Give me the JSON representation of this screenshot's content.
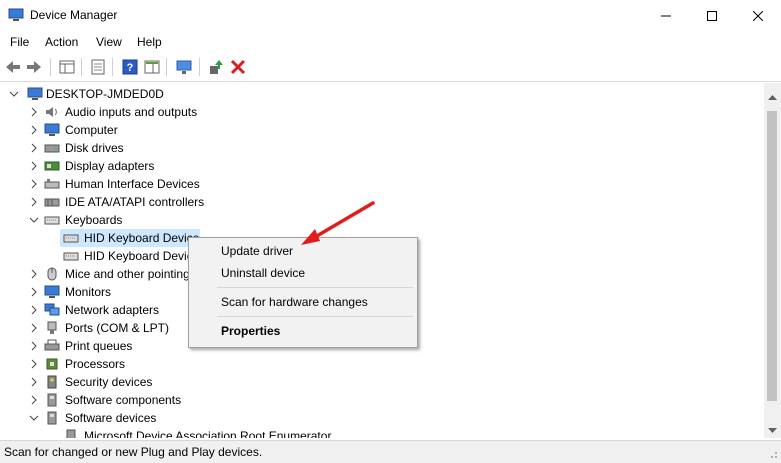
{
  "window": {
    "title": "Device Manager"
  },
  "menu": [
    "File",
    "Action",
    "View",
    "Help"
  ],
  "tree": {
    "root": "DESKTOP-JMDED0D",
    "categories": [
      "Audio inputs and outputs",
      "Computer",
      "Disk drives",
      "Display adapters",
      "Human Interface Devices",
      "IDE ATA/ATAPI controllers",
      "Keyboards",
      "Mice and other pointing devices",
      "Monitors",
      "Network adapters",
      "Ports (COM & LPT)",
      "Print queues",
      "Processors",
      "Security devices",
      "Software components",
      "Software devices"
    ],
    "keyboard_devices": [
      "HID Keyboard Device",
      "HID Keyboard Device"
    ],
    "software_devices": [
      "Microsoft Device Association Root Enumerator"
    ]
  },
  "context_menu": {
    "update": "Update driver",
    "uninstall": "Uninstall device",
    "scan": "Scan for hardware changes",
    "properties": "Properties"
  },
  "status": "Scan for changed or new Plug and Play devices.",
  "colors": {
    "selection": "#cce8ff",
    "arrow": "#e21b1b",
    "delete": "#d42020"
  }
}
